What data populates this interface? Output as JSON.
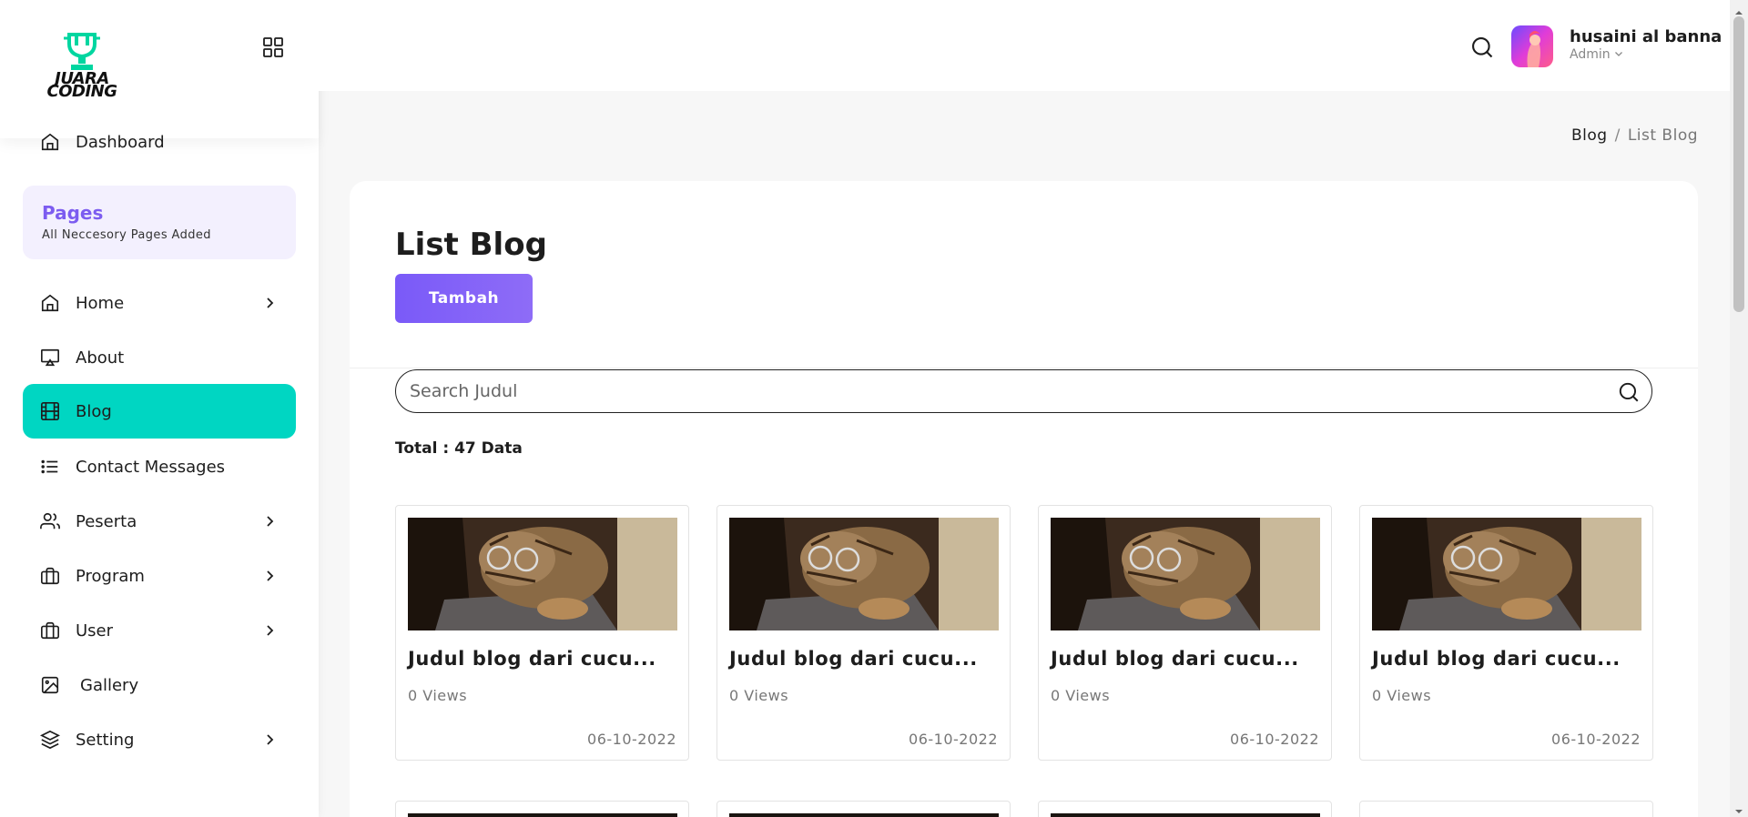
{
  "brand": {
    "line1": "JUARA",
    "line2": "CODING",
    "accent": "#00d6a0"
  },
  "sidebar": {
    "dashboard_label": "Dashboard",
    "pages_title": "Pages",
    "pages_subtitle": "All Neccesory Pages Added",
    "items": [
      {
        "label": "Home",
        "icon": "home-icon",
        "has_submenu": true
      },
      {
        "label": "About",
        "icon": "monitor-icon",
        "has_submenu": false
      },
      {
        "label": "Blog",
        "icon": "film-icon",
        "has_submenu": false,
        "active": true
      },
      {
        "label": "Contact Messages",
        "icon": "list-icon",
        "has_submenu": false
      },
      {
        "label": "Peserta",
        "icon": "users-icon",
        "has_submenu": true
      },
      {
        "label": "Program",
        "icon": "briefcase-icon",
        "has_submenu": true
      },
      {
        "label": "User",
        "icon": "briefcase-icon",
        "has_submenu": true
      },
      {
        "label": "Gallery",
        "icon": "image-icon",
        "has_submenu": false
      },
      {
        "label": "Setting",
        "icon": "layers-icon",
        "has_submenu": true
      }
    ],
    "active_color": "#00d6c2"
  },
  "header": {
    "user_name": "husaini al banna",
    "user_role": "Admin",
    "breadcrumb_parent": "Blog",
    "breadcrumb_separator": "/",
    "breadcrumb_current": "List Blog"
  },
  "main": {
    "title": "List Blog",
    "add_button": "Tambah",
    "search_placeholder": "Search Judul",
    "total_text": "Total : 47 Data",
    "accent": "#7a5af8",
    "posts": [
      {
        "title": "Judul blog dari cucu...",
        "views": "0 Views",
        "date": "06-10-2022"
      },
      {
        "title": "Judul blog dari cucu...",
        "views": "0 Views",
        "date": "06-10-2022"
      },
      {
        "title": "Judul blog dari cucu...",
        "views": "0 Views",
        "date": "06-10-2022"
      },
      {
        "title": "Judul blog dari cucu...",
        "views": "0 Views",
        "date": "06-10-2022"
      }
    ]
  }
}
